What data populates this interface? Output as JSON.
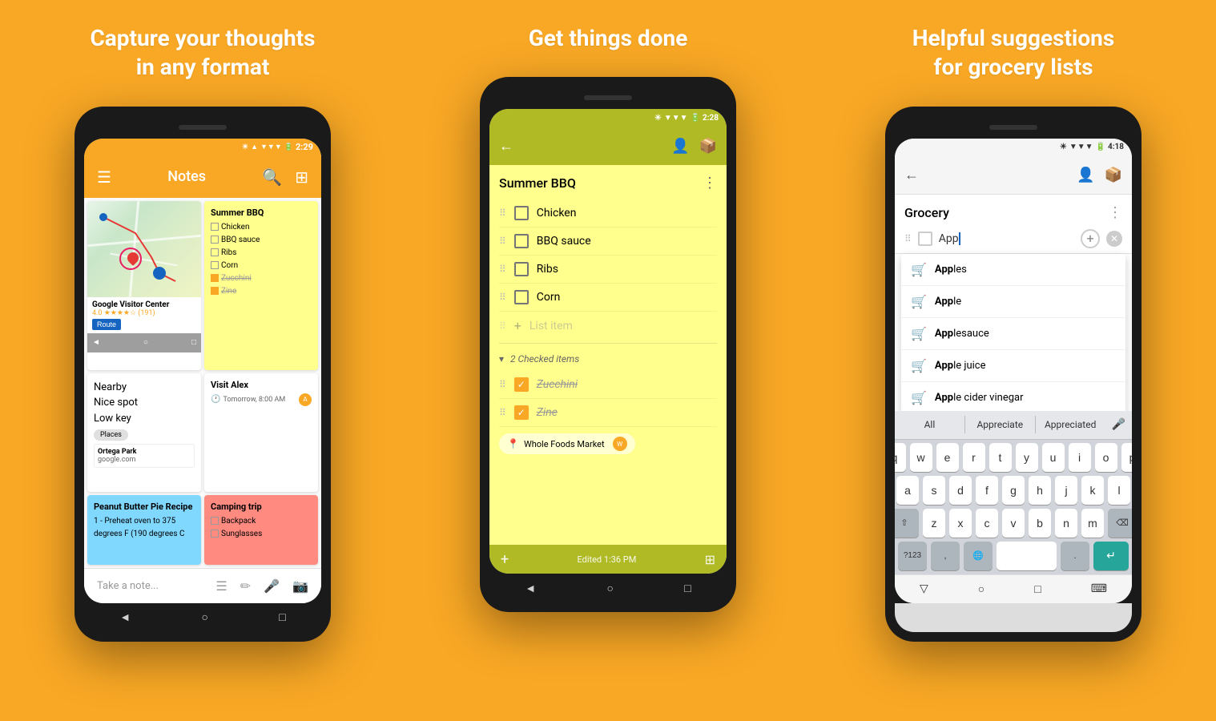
{
  "sections": [
    {
      "id": "capture",
      "title": "Capture your thoughts\nin any format",
      "phone": {
        "statusBar": {
          "time": "2:29",
          "bg": "#F9A825"
        },
        "header": {
          "title": "Notes",
          "bg": "#F9A825"
        },
        "notes": [
          {
            "type": "map",
            "subItems": [
              "Nearby",
              "Nice spot",
              "Low key"
            ],
            "places": "Places",
            "mapInfo": {
              "title": "Google Visitor Center",
              "stars": "4.0 ★★★★☆ (191)"
            }
          },
          {
            "type": "checklist",
            "title": "Summer BBQ",
            "items": [
              "Chicken",
              "BBQ sauce",
              "Ribs",
              "Corn"
            ],
            "checkedItems": [
              "Zucchini",
              "Zine"
            ]
          },
          {
            "type": "text",
            "title": "Visit Alex",
            "time": "Tomorrow, 8:00 AM"
          },
          {
            "type": "link",
            "title": "",
            "linkTitle": "Ortega Park",
            "linkUrl": "google.com"
          },
          {
            "type": "text",
            "title": "Peanut Butter Pie Recipe",
            "body": "1 - Preheat oven to 375 degrees F (190 degrees C",
            "color": "blue"
          },
          {
            "type": "checklist-small",
            "title": "Camping trip",
            "items": [
              "Backpack",
              "Sunglasses"
            ],
            "color": "red"
          }
        ],
        "bottomBar": {
          "placeholder": "Take a note..."
        },
        "nav": [
          "◄",
          "○",
          "□"
        ]
      }
    },
    {
      "id": "checklist",
      "title": "Get things done",
      "phone": {
        "statusBar": {
          "time": "2:28",
          "bg": "#AFBA25"
        },
        "header": {
          "bg": "#AFBA25"
        },
        "note": {
          "title": "Summer BBQ",
          "items": [
            "Chicken",
            "BBQ sauce",
            "Ribs",
            "Corn"
          ],
          "listItemPlaceholder": "List item",
          "checkedLabel": "2 Checked items",
          "checkedItems": [
            "Zucchini",
            "Zine"
          ],
          "location": "Whole Foods Market"
        },
        "bottom": {
          "editedText": "Edited 1:36 PM",
          "bg": "#AFBA25"
        },
        "nav": [
          "◄",
          "○",
          "□"
        ]
      }
    },
    {
      "id": "grocery",
      "title": "Helpful suggestions\nfor grocery lists",
      "phone": {
        "statusBar": {
          "time": "4:18",
          "bg": "#f5f5f5"
        },
        "header": {
          "bg": "#f5f5f5"
        },
        "note": {
          "title": "Grocery",
          "inputValue": "App",
          "cursor": true
        },
        "suggestions": [
          {
            "text": "Apples",
            "bold": "App"
          },
          {
            "text": "Apple",
            "bold": "App"
          },
          {
            "text": "Applesauce",
            "bold": "App"
          },
          {
            "text": "Apple juice",
            "bold": "App"
          },
          {
            "text": "Apple cider vinegar",
            "bold": "App"
          }
        ],
        "keyboard": {
          "suggestions": [
            "All",
            "Appreciate",
            "Appreciated"
          ],
          "rows": [
            [
              "q",
              "w",
              "e",
              "r",
              "t",
              "y",
              "u",
              "i",
              "o",
              "p"
            ],
            [
              "a",
              "s",
              "d",
              "f",
              "g",
              "h",
              "j",
              "k",
              "l"
            ],
            [
              "⇧",
              "z",
              "x",
              "c",
              "v",
              "b",
              "n",
              "m",
              "⌫"
            ],
            [
              "?123",
              ",",
              "🌐",
              " ",
              ".",
              "↵"
            ]
          ]
        },
        "nav": [
          "▽",
          "○",
          "□",
          "⌨"
        ]
      }
    }
  ]
}
